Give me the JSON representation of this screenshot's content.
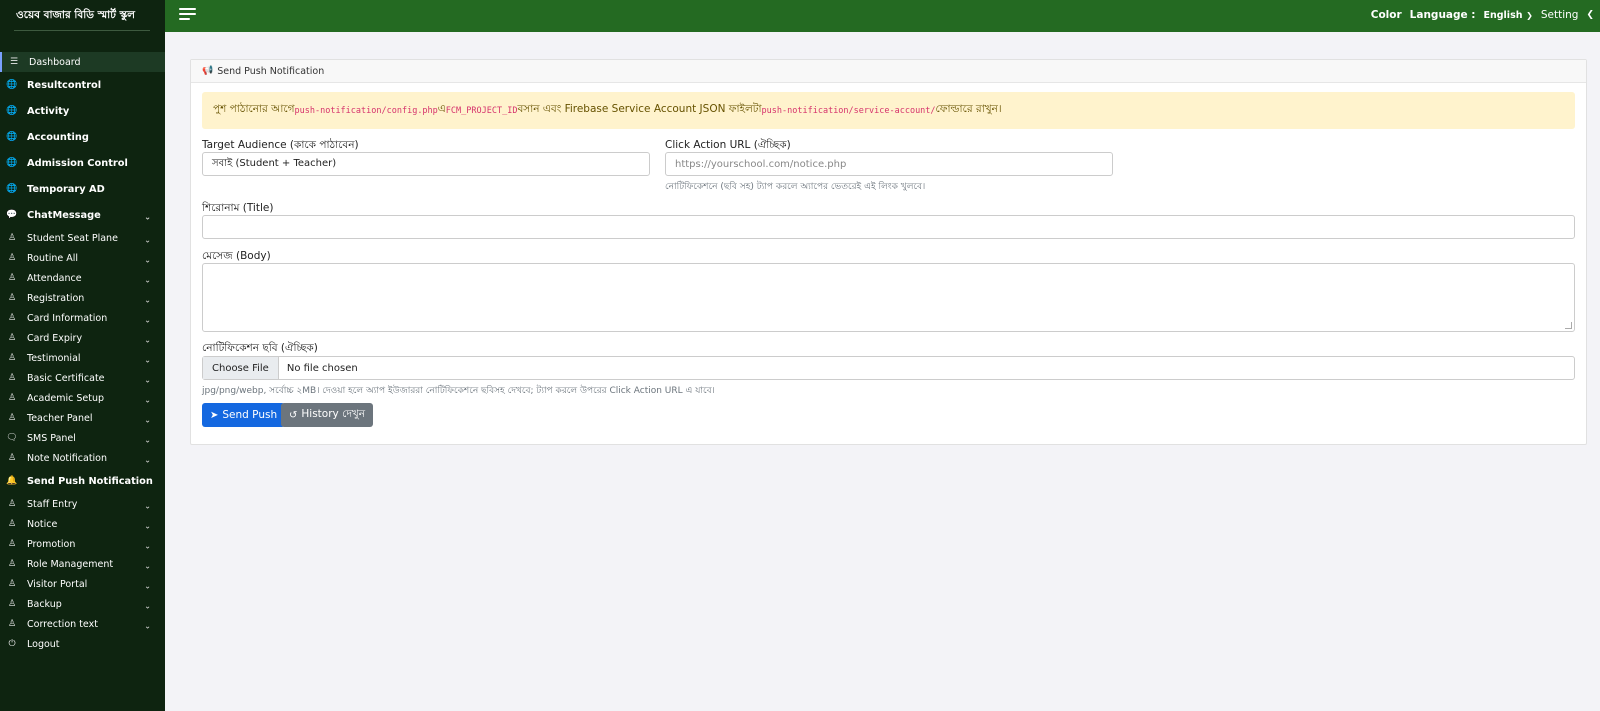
{
  "brand": {
    "title": "ওয়েব বাজার বিডি স্মার্ট স্কুল"
  },
  "sidebar": {
    "items": [
      {
        "label": "Dashboard",
        "icon": "sliders-icon",
        "active": true,
        "big": false,
        "chevron": false
      },
      {
        "label": "Resultcontrol",
        "icon": "globe-icon",
        "big": true,
        "chevron": false
      },
      {
        "label": "Activity",
        "icon": "globe-icon",
        "big": true,
        "chevron": false
      },
      {
        "label": "Accounting",
        "icon": "globe-icon",
        "big": true,
        "chevron": false
      },
      {
        "label": "Admission Control",
        "icon": "globe-icon",
        "big": true,
        "chevron": false
      },
      {
        "label": "Temporary AD",
        "icon": "globe-icon",
        "big": true,
        "chevron": false
      },
      {
        "label": "ChatMessage",
        "icon": "chat-icon",
        "big": true,
        "chevron": true
      },
      {
        "label": "Student Seat Plane",
        "icon": "user-tie-icon",
        "chevron": true
      },
      {
        "label": "Routine All",
        "icon": "user-tie-icon",
        "chevron": true
      },
      {
        "label": "Attendance",
        "icon": "user-tie-icon",
        "chevron": true
      },
      {
        "label": "Registration",
        "icon": "user-tie-icon",
        "chevron": true
      },
      {
        "label": "Card Information",
        "icon": "user-tie-icon",
        "chevron": true
      },
      {
        "label": "Card Expiry",
        "icon": "user-tie-icon",
        "chevron": true
      },
      {
        "label": "Testimonial",
        "icon": "user-tie-icon",
        "chevron": true
      },
      {
        "label": "Basic Certificate",
        "icon": "user-tie-icon",
        "chevron": true
      },
      {
        "label": "Academic Setup",
        "icon": "user-tie-icon",
        "chevron": true
      },
      {
        "label": "Teacher Panel",
        "icon": "user-tie-icon",
        "chevron": true
      },
      {
        "label": "SMS Panel",
        "icon": "comment-icon",
        "chevron": true
      },
      {
        "label": "Note Notification",
        "icon": "user-tie-icon",
        "chevron": true
      },
      {
        "label": "Send Push Notification",
        "icon": "bell-icon",
        "big": true,
        "chevron": false
      },
      {
        "label": "Staff Entry",
        "icon": "user-tie-icon",
        "chevron": true
      },
      {
        "label": "Notice",
        "icon": "user-tie-icon",
        "chevron": true
      },
      {
        "label": "Promotion",
        "icon": "user-tie-icon",
        "chevron": true
      },
      {
        "label": "Role Management",
        "icon": "user-tie-icon",
        "chevron": true
      },
      {
        "label": "Visitor Portal",
        "icon": "user-tie-icon",
        "chevron": true
      },
      {
        "label": "Backup",
        "icon": "user-tie-icon",
        "chevron": true
      },
      {
        "label": "Correction text",
        "icon": "user-tie-icon",
        "chevron": true
      },
      {
        "label": "Logout",
        "icon": "power-icon",
        "chevron": false
      }
    ]
  },
  "topbar": {
    "color_label": "Color",
    "language_label": "Language :",
    "language_value": "English",
    "setting_label": "Setting"
  },
  "card": {
    "header_title": "Send Push Notification",
    "alert": {
      "part1": "পুশ পাঠানোর আগে",
      "code1": "push-notification/config.php",
      "part2": " এ ",
      "code2": "FCM_PROJECT_ID",
      "part3": " বসান এবং Firebase Service Account JSON ফাইলটা ",
      "code3": "push-notification/service-account/",
      "part4": " ফোল্ডারে রাখুন।"
    },
    "form": {
      "audience_label": "Target Audience (কাকে পাঠাবেন)",
      "audience_value": "সবাই (Student + Teacher)",
      "url_label": "Click Action URL (ঐচ্ছিক)",
      "url_placeholder": "https://yourschool.com/notice.php",
      "url_help": "নোটিফিকেশনে (ছবি সহ) ট্যাপ করলে অ্যাপের ভেতরেই এই লিংক খুলবে।",
      "title_label": "শিরোনাম (Title)",
      "body_label": "মেসেজ (Body)",
      "image_label": "নোটিফিকেশন ছবি (ঐচ্ছিক)",
      "choose_file": "Choose File",
      "no_file": "No file chosen",
      "image_help": "jpg/png/webp, সর্বোচ্চ ২MB। দেওয়া হলে অ্যাপ ইউজাররা নোটিফিকেশনে ছবিসহ দেখবে; ট্যাপ করলে উপরের Click Action URL এ যাবে।"
    },
    "buttons": {
      "send": "Send Push",
      "history": "History দেখুন"
    }
  },
  "colors": {
    "sidebar_bg": "#0e2410",
    "topbar_bg": "#246a22",
    "primary": "#1468e0",
    "alert_bg": "#fff3cd"
  }
}
